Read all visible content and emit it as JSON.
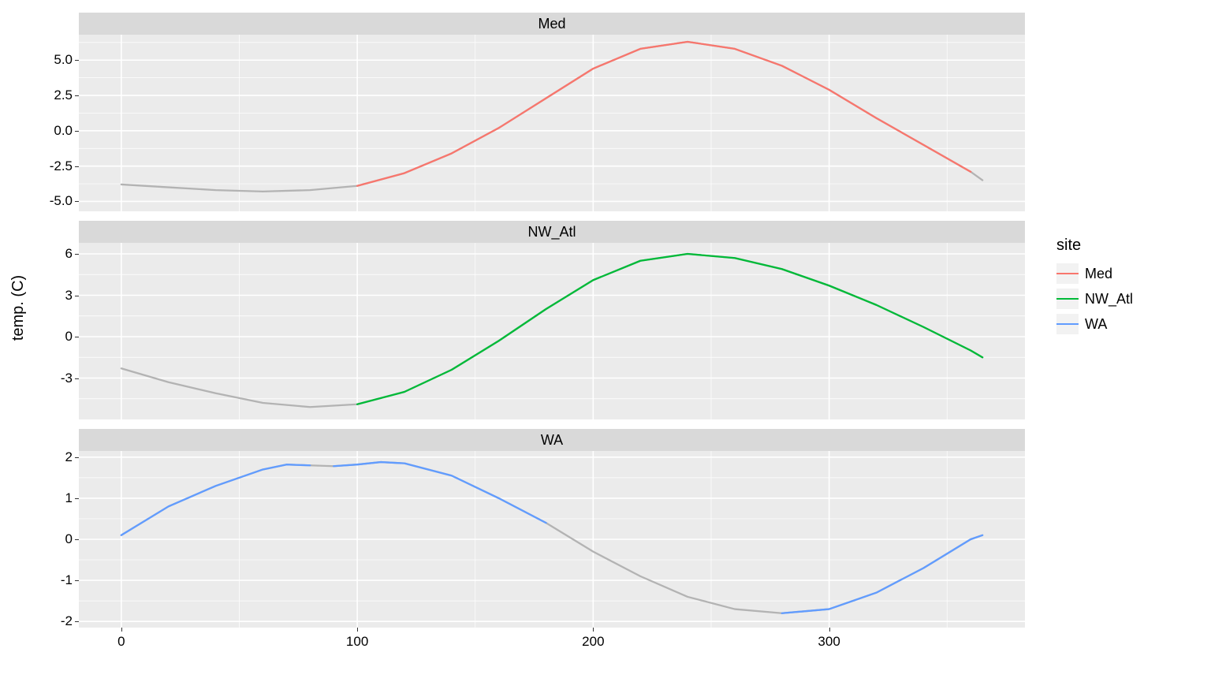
{
  "ylabel": "temp. (C)",
  "legend_title": "site",
  "legend": [
    {
      "label": "Med",
      "color": "#f8766d"
    },
    {
      "label": "NW_Atl",
      "color": "#00ba38"
    },
    {
      "label": "WA",
      "color": "#619cff"
    }
  ],
  "x_ticks": [
    0,
    100,
    200,
    300
  ],
  "x_range": [
    -18,
    383
  ],
  "facets": [
    {
      "title": "Med",
      "y_ticks": [
        -5.0,
        -2.5,
        0.0,
        2.5,
        5.0
      ],
      "y_tick_labels": [
        "-5.0",
        "-2.5",
        "0.0",
        "2.5",
        "5.0"
      ],
      "y_range": [
        -5.7,
        6.8
      ]
    },
    {
      "title": "NW_Atl",
      "y_ticks": [
        -3,
        0,
        3,
        6
      ],
      "y_tick_labels": [
        "-3",
        "0",
        "3",
        "6"
      ],
      "y_range": [
        -6.0,
        6.8
      ]
    },
    {
      "title": "WA",
      "y_ticks": [
        -2,
        -1,
        0,
        1,
        2
      ],
      "y_tick_labels": [
        "-2",
        "-1",
        "0",
        "1",
        "2"
      ],
      "y_range": [
        -2.15,
        2.15
      ]
    }
  ],
  "chart_data": [
    {
      "type": "line",
      "facet": "Med",
      "title": "Med",
      "xlabel": "",
      "ylabel": "temp. (C)",
      "x_range": [
        -18,
        383
      ],
      "y_range": [
        -5.7,
        6.8
      ],
      "x": [
        0,
        20,
        40,
        60,
        80,
        100,
        120,
        140,
        160,
        180,
        200,
        220,
        240,
        260,
        280,
        300,
        320,
        340,
        360,
        365
      ],
      "series": [
        {
          "name": "grey",
          "color": "#b3b3b3",
          "values": [
            -3.8,
            -4.0,
            -4.2,
            -4.3,
            -4.2,
            -3.9,
            -3.0,
            -1.6,
            0.2,
            2.3,
            4.4,
            5.8,
            6.3,
            5.8,
            4.6,
            2.9,
            0.9,
            -1.0,
            -2.9,
            -3.5
          ]
        },
        {
          "name": "Med",
          "color": "#f8766d",
          "values": [
            null,
            null,
            null,
            null,
            null,
            -3.9,
            -3.0,
            -1.6,
            0.2,
            2.3,
            4.4,
            5.8,
            6.3,
            5.8,
            4.6,
            2.9,
            0.9,
            -1.0,
            -2.9,
            null
          ]
        }
      ]
    },
    {
      "type": "line",
      "facet": "NW_Atl",
      "title": "NW_Atl",
      "xlabel": "",
      "ylabel": "temp. (C)",
      "x_range": [
        -18,
        383
      ],
      "y_range": [
        -6.0,
        6.8
      ],
      "x": [
        0,
        20,
        40,
        60,
        80,
        100,
        120,
        140,
        160,
        180,
        200,
        220,
        240,
        260,
        280,
        300,
        320,
        340,
        360,
        365
      ],
      "series": [
        {
          "name": "grey",
          "color": "#b3b3b3",
          "values": [
            -2.3,
            -3.3,
            -4.1,
            -4.8,
            -5.1,
            -4.9,
            -4.0,
            -2.4,
            -0.3,
            2.0,
            4.1,
            5.5,
            6.0,
            5.7,
            4.9,
            3.7,
            2.3,
            0.7,
            -1.0,
            -1.5
          ]
        },
        {
          "name": "NW_Atl",
          "color": "#00ba38",
          "values": [
            null,
            null,
            null,
            null,
            null,
            -4.9,
            -4.0,
            -2.4,
            -0.3,
            2.0,
            4.1,
            5.5,
            6.0,
            5.7,
            4.9,
            3.7,
            2.3,
            0.7,
            -1.0,
            -1.5
          ]
        }
      ]
    },
    {
      "type": "line",
      "facet": "WA",
      "title": "WA",
      "xlabel": "",
      "ylabel": "temp. (C)",
      "x_range": [
        -18,
        383
      ],
      "y_range": [
        -2.15,
        2.15
      ],
      "x": [
        0,
        20,
        40,
        60,
        70,
        80,
        90,
        100,
        110,
        120,
        140,
        160,
        180,
        200,
        220,
        240,
        260,
        280,
        300,
        320,
        340,
        360,
        365
      ],
      "series": [
        {
          "name": "grey",
          "color": "#b3b3b3",
          "values": [
            0.1,
            0.8,
            1.3,
            1.7,
            1.82,
            1.8,
            1.78,
            1.82,
            1.88,
            1.85,
            1.55,
            1.0,
            0.4,
            -0.3,
            -0.9,
            -1.4,
            -1.7,
            -1.8,
            -1.7,
            -1.3,
            -0.7,
            0.0,
            0.1
          ]
        },
        {
          "name": "WA_seg1",
          "color": "#619cff",
          "values": [
            0.1,
            0.8,
            1.3,
            1.7,
            1.82,
            1.8,
            null,
            null,
            null,
            null,
            null,
            null,
            null,
            null,
            null,
            null,
            null,
            null,
            null,
            null,
            null,
            null,
            null
          ]
        },
        {
          "name": "WA_seg2",
          "color": "#619cff",
          "values": [
            null,
            null,
            null,
            null,
            null,
            null,
            1.78,
            1.82,
            1.88,
            1.85,
            1.55,
            1.0,
            0.4,
            null,
            null,
            null,
            null,
            null,
            null,
            null,
            null,
            null,
            null
          ]
        },
        {
          "name": "WA_seg3",
          "color": "#619cff",
          "values": [
            null,
            null,
            null,
            null,
            null,
            null,
            null,
            null,
            null,
            null,
            null,
            null,
            null,
            null,
            null,
            null,
            null,
            -1.8,
            -1.7,
            -1.3,
            -0.7,
            0.0,
            0.1
          ]
        }
      ]
    }
  ]
}
